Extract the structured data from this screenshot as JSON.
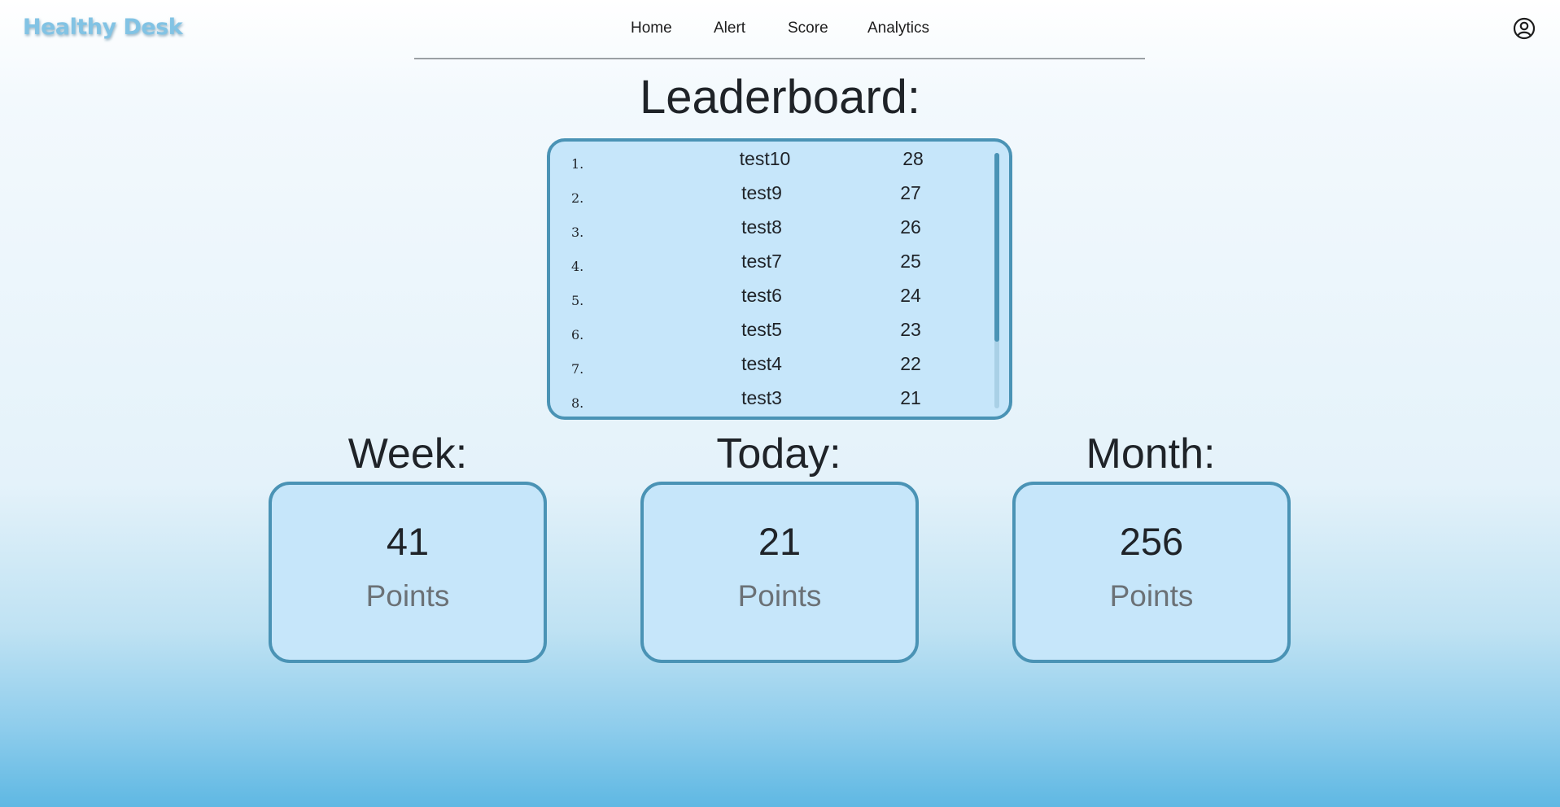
{
  "app": {
    "brand": "Healthy Desk"
  },
  "nav": {
    "items": [
      "Home",
      "Alert",
      "Score",
      "Analytics"
    ]
  },
  "header": {
    "profile_icon": "user-circle-icon"
  },
  "leaderboard": {
    "title": "Leaderboard:",
    "rows": [
      {
        "rank": "1.",
        "name": "test10",
        "score": "28"
      },
      {
        "rank": "2.",
        "name": "test9",
        "score": "27"
      },
      {
        "rank": "3.",
        "name": "test8",
        "score": "26"
      },
      {
        "rank": "4.",
        "name": "test7",
        "score": "25"
      },
      {
        "rank": "5.",
        "name": "test6",
        "score": "24"
      },
      {
        "rank": "6.",
        "name": "test5",
        "score": "23"
      },
      {
        "rank": "7.",
        "name": "test4",
        "score": "22"
      },
      {
        "rank": "8.",
        "name": "test3",
        "score": "21"
      }
    ]
  },
  "stats": [
    {
      "title": "Week:",
      "value": "41",
      "unit": "Points"
    },
    {
      "title": "Today:",
      "value": "21",
      "unit": "Points"
    },
    {
      "title": "Month:",
      "value": "256",
      "unit": "Points"
    }
  ],
  "colors": {
    "accent": "#4a93b5",
    "card_bg": "#c6e6fa",
    "brand": "#82c3e4"
  }
}
